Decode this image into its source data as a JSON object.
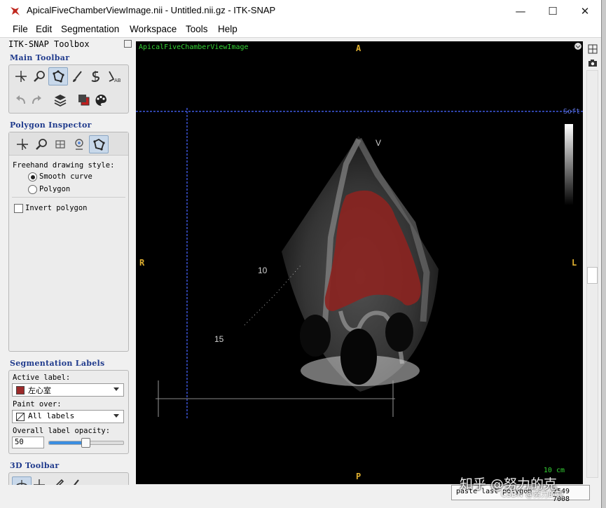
{
  "window": {
    "title": "ApicalFiveChamberViewImage.nii - Untitled.nii.gz - ITK-SNAP",
    "minimize": "—",
    "maximize": "☐",
    "close": "✕"
  },
  "menu": [
    "File",
    "Edit",
    "Segmentation",
    "Workspace",
    "Tools",
    "Help"
  ],
  "toolbox": {
    "title": "ITK-SNAP Toolbox",
    "main_toolbar": {
      "heading": "Main Toolbar",
      "tools": [
        "crosshair-icon",
        "zoom-icon",
        "polygon-icon",
        "paintbrush-icon",
        "snake-icon",
        "annotation-icon"
      ],
      "active_tool": "polygon-icon",
      "row2": [
        "undo-icon",
        "redo-icon",
        "layers-icon",
        "label-icon",
        "palette-icon"
      ]
    },
    "polygon_inspector": {
      "heading": "Polygon Inspector",
      "tools": [
        "crosshair-icon",
        "zoom-icon",
        "thumbnail-icon",
        "screenshot-icon",
        "polygon-icon"
      ],
      "freehand_label": "Freehand drawing style:",
      "options": [
        "Smooth curve",
        "Polygon"
      ],
      "selected_option": "Smooth curve",
      "invert_label": "Invert polygon",
      "invert_checked": false
    },
    "segmentation_labels": {
      "heading": "Segmentation Labels",
      "active_label_caption": "Active label:",
      "active_label": "左心室",
      "active_label_color": "#9c2a2a",
      "paint_over_caption": "Paint over:",
      "paint_over": "All labels",
      "opacity_caption": "Overall label opacity:",
      "opacity_value": "50",
      "opacity_fraction": 0.5
    },
    "toolbar_3d": {
      "heading": "3D Toolbar",
      "tools": [
        "rotate-icon",
        "crosshair-icon",
        "scalpel-icon",
        "spraypaint-icon"
      ]
    }
  },
  "viewer": {
    "image_name": "ApicalFiveChamberViewImage",
    "orient_top": "A",
    "orient_bottom": "P",
    "orient_left": "R",
    "orient_right": "L",
    "colormap_label": "Soft",
    "scale_label": "10 cm",
    "depth_marks": [
      "10",
      "15"
    ],
    "probe_marker": "V",
    "segmentation_color": "#8c2420"
  },
  "status": {
    "paste_button": "paste last polygon",
    "coords": "2549 7008",
    "watermark": "知乎 @努力的克",
    "watermark_small": "CSDN @努力的克"
  }
}
